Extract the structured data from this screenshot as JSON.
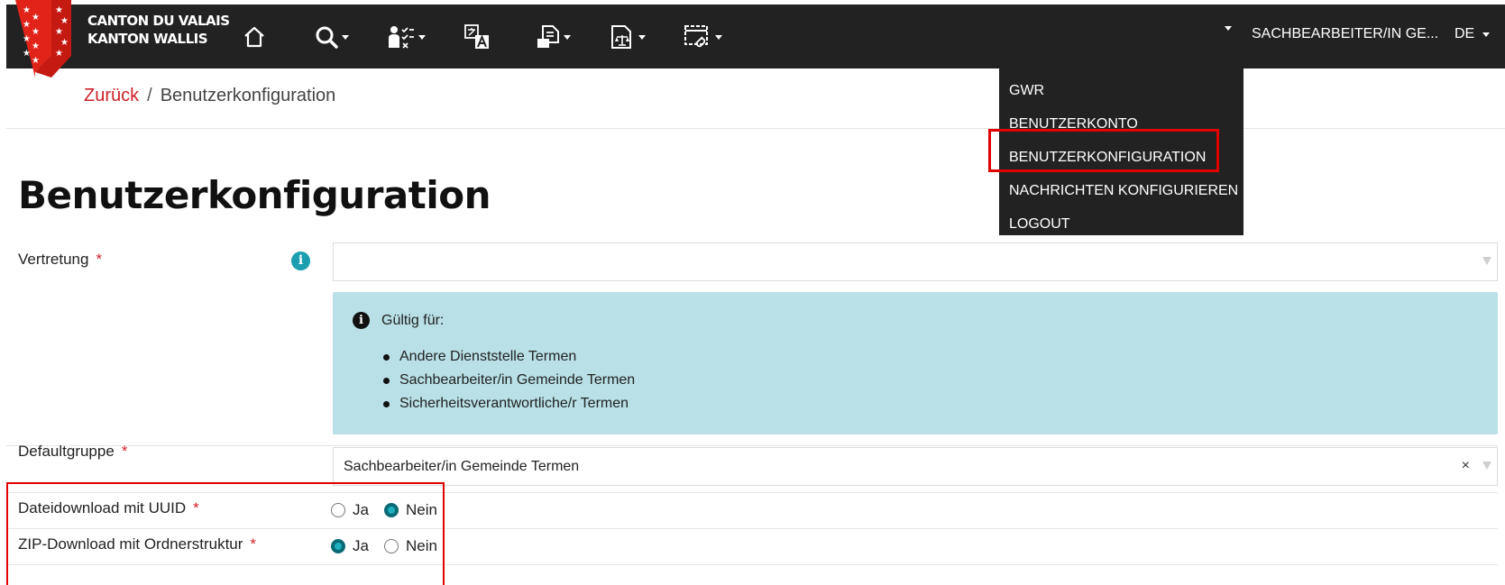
{
  "navbar": {
    "logo_line1": "CANTON DU VALAIS",
    "logo_line2": "KANTON WALLIS",
    "icons": [
      "home-icon",
      "search-icon",
      "checklist-icon",
      "translate-icon",
      "document-icon",
      "scales-document-icon",
      "browser-link-icon"
    ],
    "role_label": "SACHBEARBEITER/IN GE...",
    "language": "DE"
  },
  "user_menu": {
    "items": [
      "GWR",
      "BENUTZERKONTO",
      "BENUTZERKONFIGURATION",
      "NACHRICHTEN KONFIGURIEREN",
      "LOGOUT"
    ],
    "highlighted": "BENUTZERKONFIGURATION"
  },
  "breadcrumb": {
    "back": "Zurück",
    "separator": "/",
    "current": "Benutzerkonfiguration"
  },
  "page": {
    "title": "Benutzerkonfiguration"
  },
  "form": {
    "vertretung": {
      "label": "Vertretung",
      "required_mark": "*",
      "value": ""
    },
    "info": {
      "header": "Gültig für:",
      "items": [
        "Andere Dienststelle Termen",
        "Sachbearbeiter/in Gemeinde Termen",
        "Sicherheitsverantwortliche/r Termen"
      ]
    },
    "defaultgruppe": {
      "label": "Defaultgruppe",
      "required_mark": "*",
      "value": "Sachbearbeiter/in Gemeinde Termen",
      "clear": "×"
    },
    "uuid_download": {
      "label": "Dateidownload mit UUID",
      "required_mark": "*",
      "options": [
        "Ja",
        "Nein"
      ],
      "selected": "Nein"
    },
    "zip_download": {
      "label": "ZIP-Download mit Ordnerstruktur",
      "required_mark": "*",
      "options": [
        "Ja",
        "Nein"
      ],
      "selected": "Ja"
    }
  },
  "colors": {
    "navbar_bg": "#222222",
    "brand_red": "#d0202a",
    "highlight_red": "#e00000",
    "info_bg": "#b8e0e6",
    "radio_teal": "#0a6a75"
  }
}
